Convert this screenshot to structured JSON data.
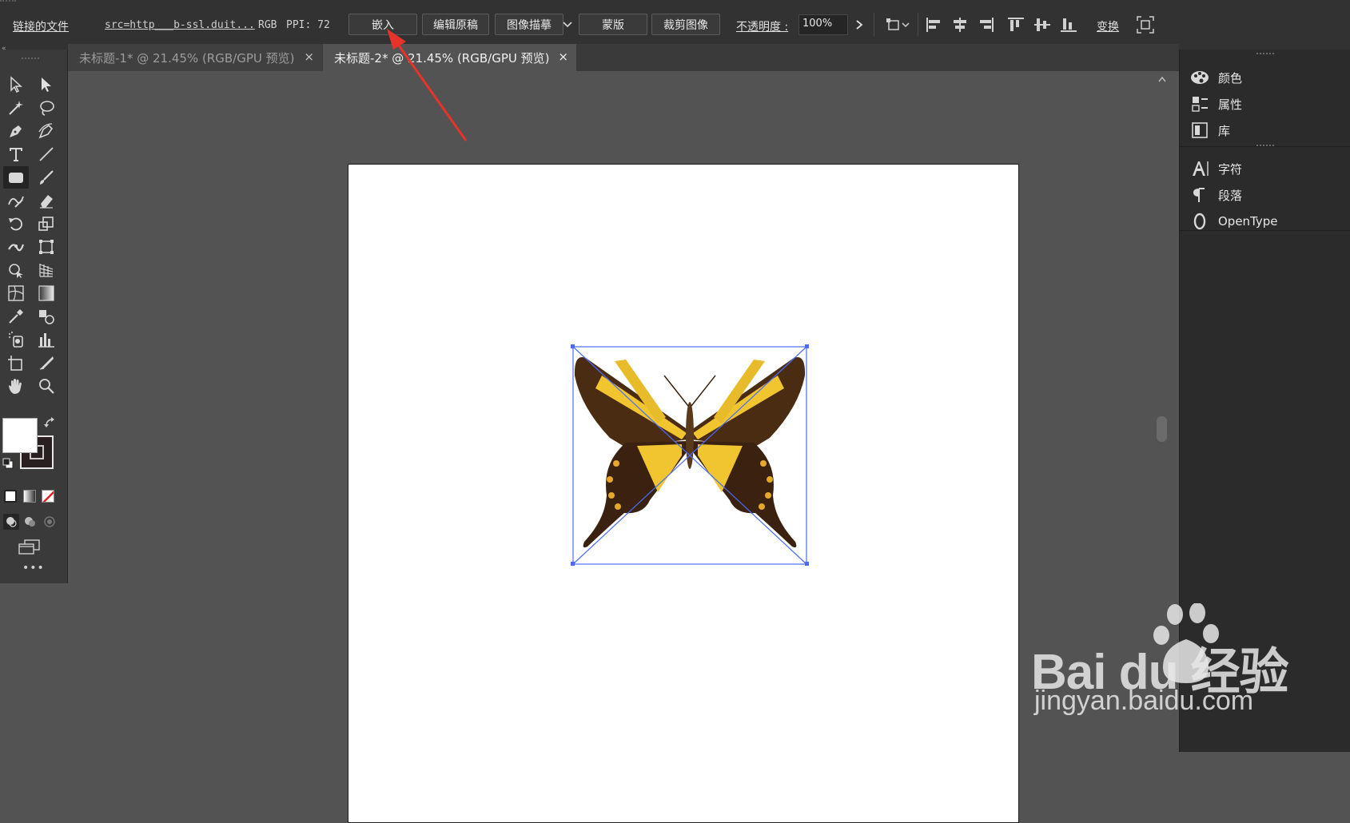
{
  "control_bar": {
    "linked_file_label": "链接的文件",
    "filename": "src=http___b-ssl.duit...",
    "color_mode": "RGB",
    "ppi": "PPI: 72",
    "embed_label": "嵌入",
    "edit_original_label": "编辑原稿",
    "image_trace_label": "图像描摹",
    "mask_label": "蒙版",
    "crop_image_label": "裁剪图像",
    "opacity_label": "不透明度 :",
    "opacity_value": "100%",
    "transform_label": "变换"
  },
  "tabs": [
    {
      "label": "未标题-1* @ 21.45% (RGB/GPU 预览)",
      "close": "×",
      "active": false
    },
    {
      "label": "未标题-2* @ 21.45% (RGB/GPU 预览)",
      "close": "×",
      "active": true
    }
  ],
  "toolbar": {
    "more_label": "•••"
  },
  "right_panels": {
    "group1": [
      {
        "icon": "color-palette-icon",
        "label": "颜色"
      },
      {
        "icon": "properties-icon",
        "label": "属性"
      },
      {
        "icon": "library-icon",
        "label": "库"
      }
    ],
    "group2": [
      {
        "icon": "character-icon",
        "label": "字符"
      },
      {
        "icon": "paragraph-icon",
        "label": "段落"
      },
      {
        "icon": "opentype-icon",
        "label": "OpenType"
      }
    ]
  },
  "watermark": {
    "brand": "Bai du 经验",
    "url": "jingyan.baidu.com"
  },
  "colors": {
    "accent_arrow": "#e8322c",
    "selection_blue": "#4a6cf7",
    "artboard": "#ffffff"
  }
}
